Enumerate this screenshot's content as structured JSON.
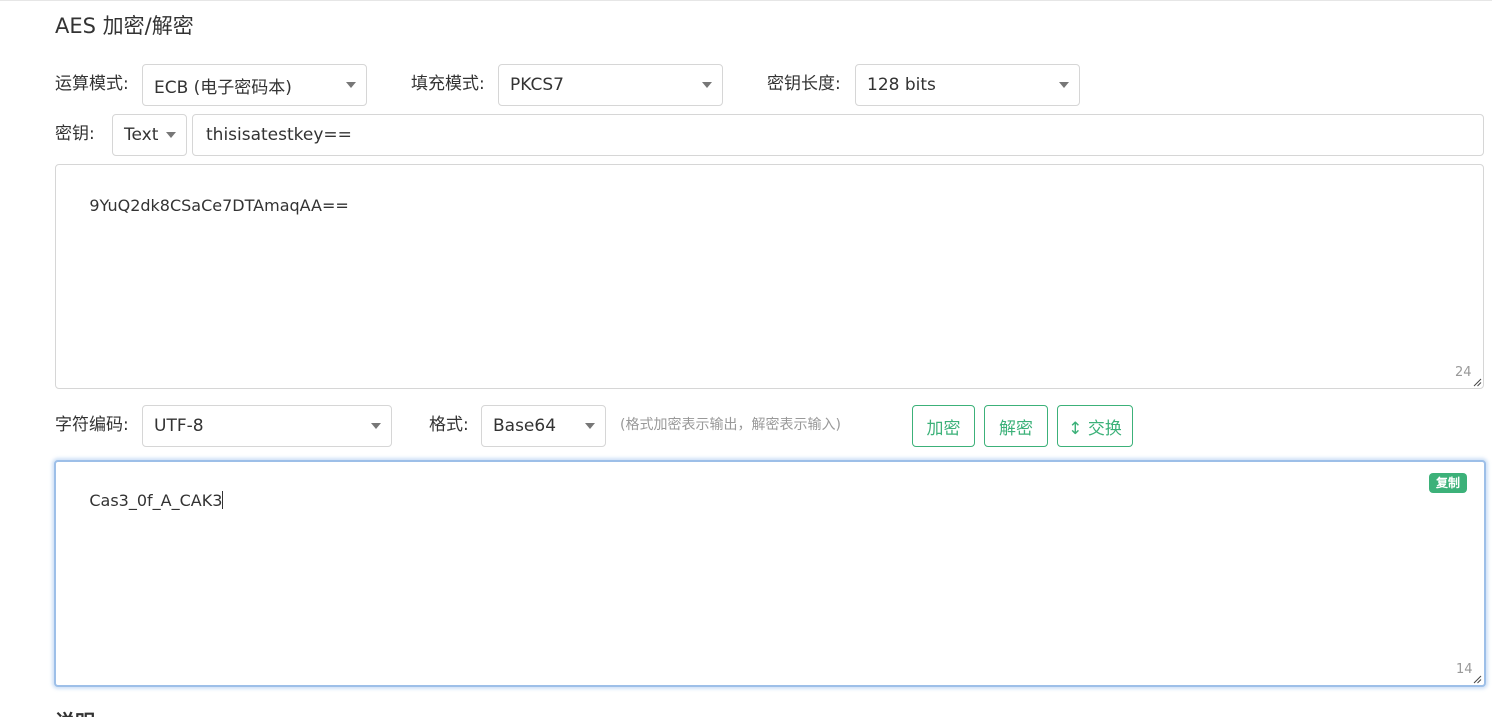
{
  "title": "AES 加密/解密",
  "mode": {
    "label": "运算模式:",
    "value": "ECB (电子密码本)"
  },
  "padding": {
    "label": "填充模式:",
    "value": "PKCS7"
  },
  "key_length": {
    "label": "密钥长度:",
    "value": "128 bits"
  },
  "key": {
    "label": "密钥:",
    "type_value": "Text",
    "value": "thisisatestkey=="
  },
  "input_area": {
    "value": "9YuQ2dk8CSaCe7DTAmaqAA==",
    "count": "24"
  },
  "charset": {
    "label": "字符编码:",
    "value": "UTF-8"
  },
  "format": {
    "label": "格式:",
    "value": "Base64",
    "hint": "(格式加密表示输出，解密表示输入)"
  },
  "buttons": {
    "encrypt": "加密",
    "decrypt": "解密",
    "swap": "↕ 交换"
  },
  "output_area": {
    "value": "Cas3_0f_A_CAK3",
    "count": "14",
    "copy_label": "复制"
  },
  "next_heading": "说明",
  "colors": {
    "accent": "#3cb179",
    "focus_border": "#9dbfe8"
  }
}
